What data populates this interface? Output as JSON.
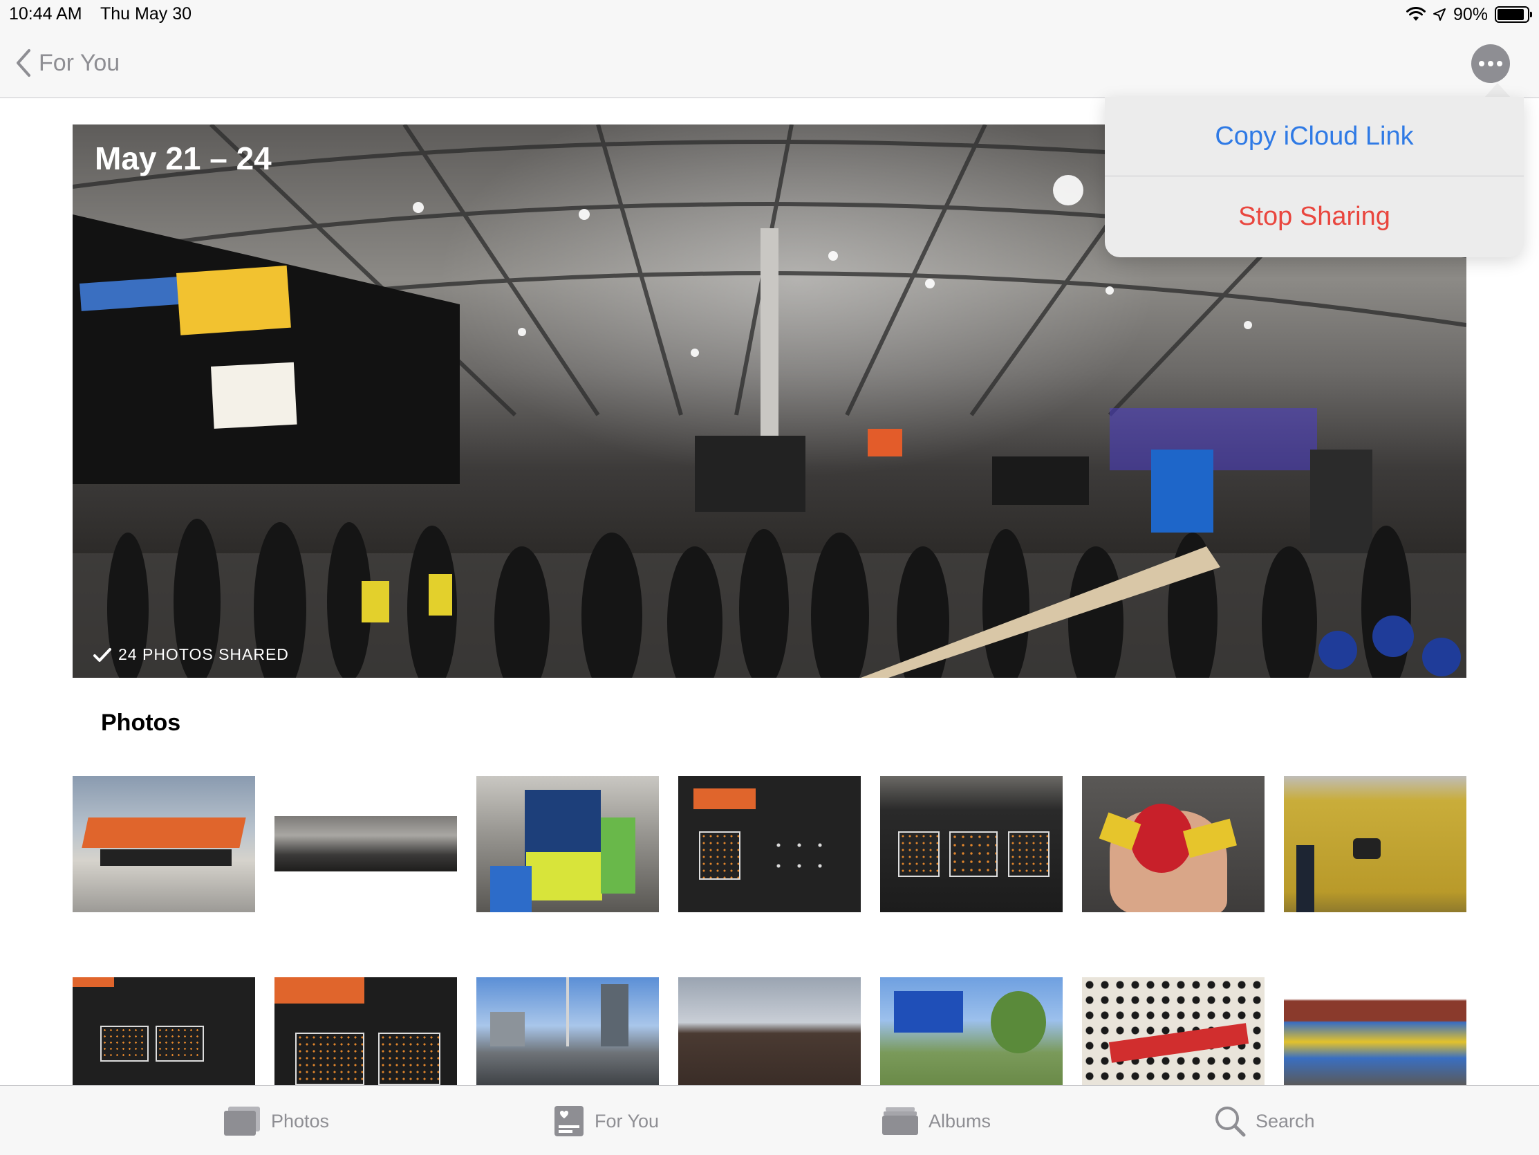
{
  "status_bar": {
    "time": "10:44 AM",
    "date": "Thu May 30",
    "battery_pct": "90%",
    "battery_level": 0.9,
    "icons": [
      "wifi-icon",
      "location-arrow-icon",
      "battery-icon"
    ]
  },
  "nav": {
    "back_label": "For You",
    "back_icon": "chevron-left-icon",
    "more_icon": "ellipsis-icon"
  },
  "hero": {
    "title": "May 21 – 24",
    "shared_label": "24 PHOTOS SHARED",
    "shared_icon": "checkmark-icon"
  },
  "popover": {
    "copy_link": "Copy iCloud Link",
    "stop_sharing": "Stop Sharing",
    "copy_color": "#2f7ae5",
    "stop_color": "#e9463e"
  },
  "photos": {
    "heading": "Photos",
    "thumbnails": [
      {
        "name": "collision-toronto-sign"
      },
      {
        "name": "convention-hall-panorama"
      },
      {
        "name": "aws-exhibit-booth"
      },
      {
        "name": "collisionconf-poll-board"
      },
      {
        "name": "poll-board-dark"
      },
      {
        "name": "bob-o-bon-candy"
      },
      {
        "name": "yellow-wall-exhibit"
      },
      {
        "name": "collisionconf-board-2"
      },
      {
        "name": "ai-robotics-poll-board"
      },
      {
        "name": "toronto-skyline-cn-tower"
      },
      {
        "name": "brick-building-sky"
      },
      {
        "name": "park-blue-building"
      },
      {
        "name": "ceiling-art-pattern"
      },
      {
        "name": "graffiti-wall"
      }
    ]
  },
  "tab_bar": {
    "tabs": [
      {
        "label": "Photos",
        "icon": "photos-stack-icon"
      },
      {
        "label": "For You",
        "icon": "for-you-icon"
      },
      {
        "label": "Albums",
        "icon": "albums-folder-icon"
      },
      {
        "label": "Search",
        "icon": "search-icon"
      }
    ]
  }
}
